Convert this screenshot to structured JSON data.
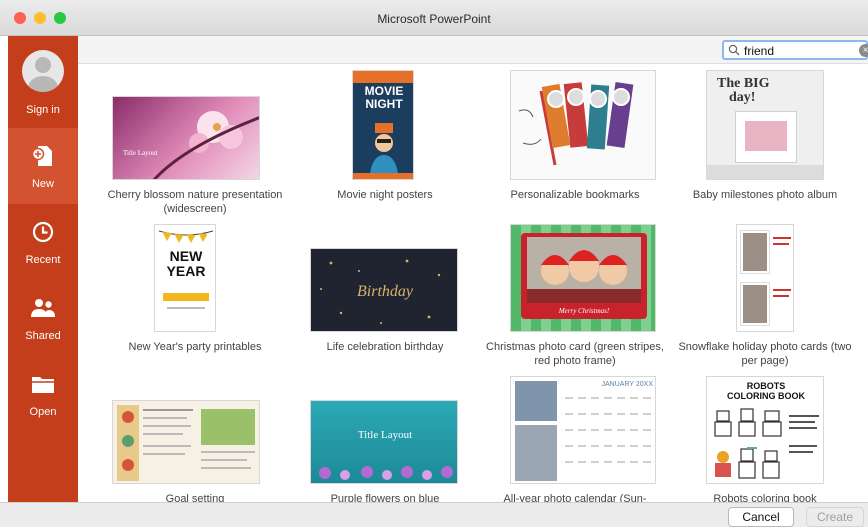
{
  "window": {
    "title": "Microsoft PowerPoint"
  },
  "sidebar": {
    "sign_in": "Sign in",
    "items": [
      {
        "label": "New",
        "icon": "new-document-icon",
        "active": true
      },
      {
        "label": "Recent",
        "icon": "clock-icon"
      },
      {
        "label": "Shared",
        "icon": "people-icon"
      },
      {
        "label": "Open",
        "icon": "folder-icon"
      }
    ]
  },
  "search": {
    "value": "friend"
  },
  "thumb_text": {
    "cherry": "Title Layout",
    "movie_1": "MOVIE",
    "movie_2": "NIGHT",
    "baby_1": "The BIG",
    "baby_2": "day!",
    "ny_1": "NEW",
    "ny_2": "YEAR",
    "birthday": "Birthday",
    "xmas": "Merry Christmas!",
    "purple": "Title Layout",
    "calendar": "JANUARY 20XX",
    "robots_1": "ROBOTS",
    "robots_2": "COLORING BOOK"
  },
  "templates": [
    {
      "caption": "Cherry blossom nature presentation (widescreen)"
    },
    {
      "caption": "Movie night posters"
    },
    {
      "caption": "Personalizable bookmarks"
    },
    {
      "caption": "Baby milestones photo album"
    },
    {
      "caption": "New Year's party printables"
    },
    {
      "caption": "Life celebration birthday"
    },
    {
      "caption": "Christmas photo card (green stripes, red photo frame)"
    },
    {
      "caption": "Snowflake holiday photo cards (two per page)"
    },
    {
      "caption": "Goal setting"
    },
    {
      "caption": "Purple flowers on blue"
    },
    {
      "caption": "All-year photo calendar (Sun-"
    },
    {
      "caption": "Robots coloring book"
    }
  ],
  "buttons": {
    "cancel": "Cancel",
    "create": "Create"
  },
  "colors": {
    "sidebar": "#c43e1c",
    "sidebar_active": "#d35230",
    "search_focus": "#8cb8ee"
  }
}
